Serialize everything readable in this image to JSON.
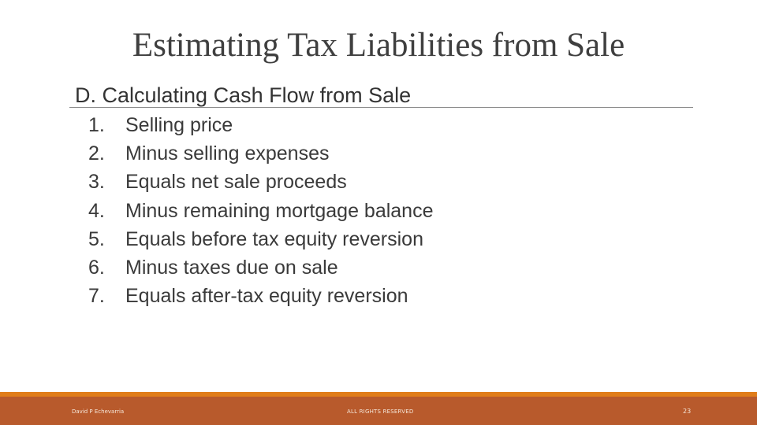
{
  "slide": {
    "title": "Estimating Tax Liabilities from Sale",
    "subtitle": "D. Calculating Cash Flow from Sale",
    "items": [
      {
        "number": "1.",
        "text": "Selling price"
      },
      {
        "number": "2.",
        "text": "Minus selling expenses"
      },
      {
        "number": "3.",
        "text": "Equals net sale proceeds"
      },
      {
        "number": "4.",
        "text": "Minus remaining mortgage balance"
      },
      {
        "number": "5.",
        "text": "Equals before tax equity reversion"
      },
      {
        "number": "6.",
        "text": "Minus taxes due on sale"
      },
      {
        "number": "7.",
        "text": "Equals after-tax equity reversion"
      }
    ]
  },
  "footer": {
    "author": "David P Echevarria",
    "rights": "ALL RIGHTS RESERVED",
    "page_number": "23"
  },
  "colors": {
    "footer_strip": "#e07d1a",
    "footer_band": "#b85a2c"
  }
}
